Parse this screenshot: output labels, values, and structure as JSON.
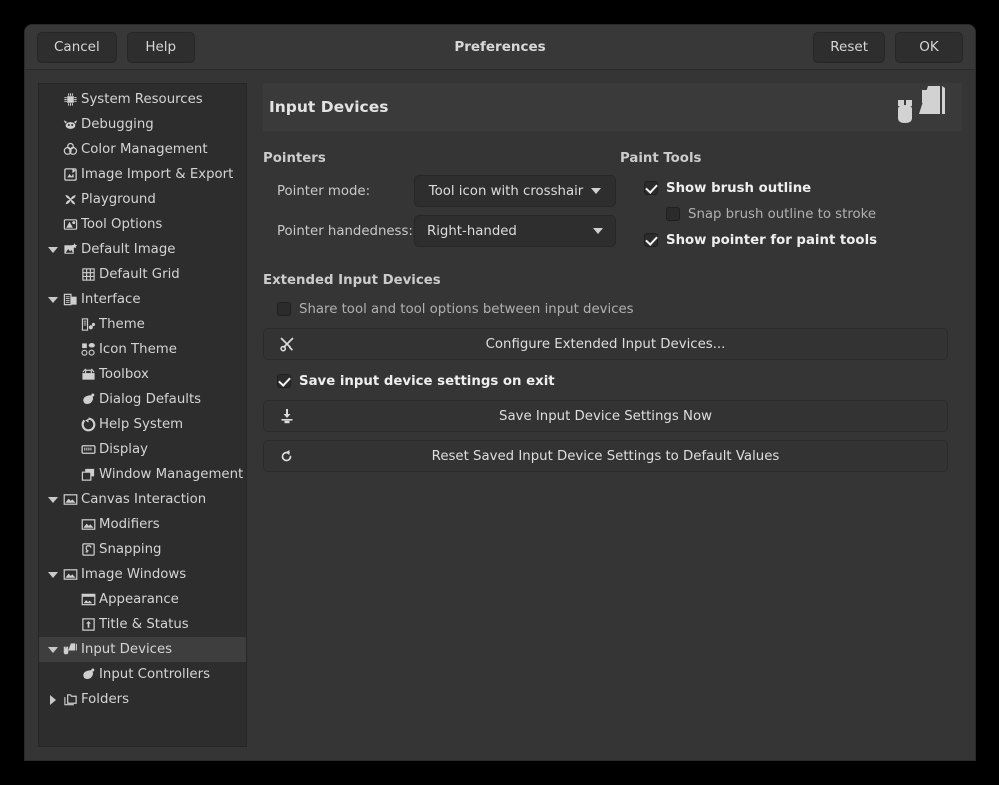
{
  "window": {
    "title": "Preferences",
    "buttons": {
      "cancel": "Cancel",
      "help": "Help",
      "reset": "Reset",
      "ok": "OK"
    }
  },
  "sidebar": {
    "items": [
      {
        "label": "System Resources",
        "icon": "cpu-chip-icon",
        "level": 0,
        "expander": "none",
        "selected": false
      },
      {
        "label": "Debugging",
        "icon": "bug-wilber-icon",
        "level": 0,
        "expander": "none",
        "selected": false
      },
      {
        "label": "Color Management",
        "icon": "color-wheels-icon",
        "level": 0,
        "expander": "none",
        "selected": false
      },
      {
        "label": "Image Import & Export",
        "icon": "image-exchange-icon",
        "level": 0,
        "expander": "none",
        "selected": false
      },
      {
        "label": "Playground",
        "icon": "pinwheel-icon",
        "level": 0,
        "expander": "none",
        "selected": false
      },
      {
        "label": "Tool Options",
        "icon": "tool-options-icon",
        "level": 0,
        "expander": "none",
        "selected": false
      },
      {
        "label": "Default Image",
        "icon": "new-image-icon",
        "level": 0,
        "expander": "expanded",
        "selected": false
      },
      {
        "label": "Default Grid",
        "icon": "grid-icon",
        "level": 1,
        "expander": "none",
        "selected": false
      },
      {
        "label": "Interface",
        "icon": "interface-icon",
        "level": 0,
        "expander": "expanded",
        "selected": false
      },
      {
        "label": "Theme",
        "icon": "theme-icon",
        "level": 1,
        "expander": "none",
        "selected": false
      },
      {
        "label": "Icon Theme",
        "icon": "icon-theme-icon",
        "level": 1,
        "expander": "none",
        "selected": false
      },
      {
        "label": "Toolbox",
        "icon": "toolbox-icon",
        "level": 1,
        "expander": "none",
        "selected": false
      },
      {
        "label": "Dialog Defaults",
        "icon": "dialog-defaults-icon",
        "level": 1,
        "expander": "none",
        "selected": false
      },
      {
        "label": "Help System",
        "icon": "help-system-icon",
        "level": 1,
        "expander": "none",
        "selected": false
      },
      {
        "label": "Display",
        "icon": "display-icon",
        "level": 1,
        "expander": "none",
        "selected": false
      },
      {
        "label": "Window Management",
        "icon": "windows-icon",
        "level": 1,
        "expander": "none",
        "selected": false
      },
      {
        "label": "Canvas Interaction",
        "icon": "canvas-icon",
        "level": 0,
        "expander": "expanded",
        "selected": false
      },
      {
        "label": "Modifiers",
        "icon": "canvas-icon",
        "level": 1,
        "expander": "none",
        "selected": false
      },
      {
        "label": "Snapping",
        "icon": "snap-icon",
        "level": 1,
        "expander": "none",
        "selected": false
      },
      {
        "label": "Image Windows",
        "icon": "canvas-icon",
        "level": 0,
        "expander": "expanded",
        "selected": false
      },
      {
        "label": "Appearance",
        "icon": "appearance-icon",
        "level": 1,
        "expander": "none",
        "selected": false
      },
      {
        "label": "Title & Status",
        "icon": "title-status-icon",
        "level": 1,
        "expander": "none",
        "selected": false
      },
      {
        "label": "Input Devices",
        "icon": "input-devices-icon",
        "level": 0,
        "expander": "expanded",
        "selected": true
      },
      {
        "label": "Input Controllers",
        "icon": "dialog-defaults-icon",
        "level": 1,
        "expander": "none",
        "selected": false
      },
      {
        "label": "Folders",
        "icon": "folders-icon",
        "level": 0,
        "expander": "collapsed",
        "selected": false
      }
    ]
  },
  "page": {
    "title": "Input Devices",
    "header_icon": "mouse-stylus-icon",
    "pointers": {
      "title": "Pointers",
      "pointer_mode": {
        "label": "Pointer mode:",
        "value": "Tool icon with crosshair"
      },
      "pointer_handedness": {
        "label": "Pointer handedness:",
        "value": "Right-handed"
      }
    },
    "paint_tools": {
      "title": "Paint Tools",
      "options": [
        {
          "label": "Show brush outline",
          "checked": true,
          "indent": 0
        },
        {
          "label": "Snap brush outline to stroke",
          "checked": false,
          "indent": 1
        },
        {
          "label": "Show pointer for paint tools",
          "checked": true,
          "indent": 0
        }
      ]
    },
    "extended": {
      "title": "Extended Input Devices",
      "share_option": {
        "label": "Share tool and tool options between input devices",
        "checked": false
      },
      "configure_button": {
        "label": "Configure Extended Input Devices...",
        "icon": "tools-icon"
      },
      "save_on_exit": {
        "label": "Save input device settings on exit",
        "checked": true
      },
      "save_now_button": {
        "label": "Save Input Device Settings Now",
        "icon": "save-download-icon"
      },
      "reset_button": {
        "label": "Reset Saved Input Device Settings to Default Values",
        "icon": "revert-icon"
      }
    }
  },
  "colors": {
    "window_bg": "#353535",
    "sidebar_bg": "#2d2d2d",
    "selected_row": "#3e3e3e",
    "header_bar": "#383838",
    "text": "#d4d4d4"
  }
}
